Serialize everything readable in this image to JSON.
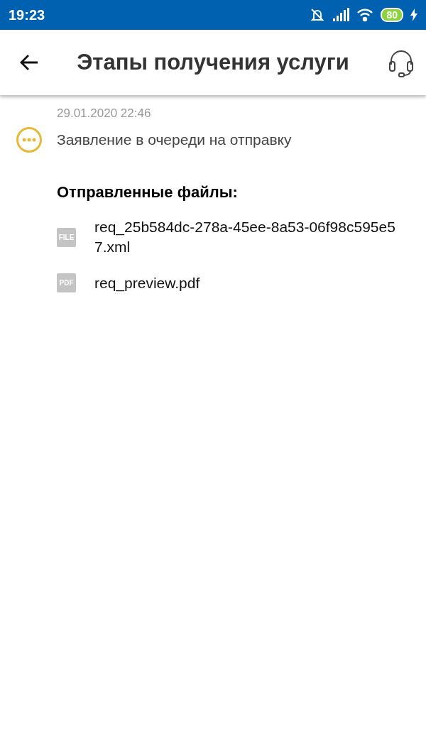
{
  "status_bar": {
    "time": "19:23",
    "battery": "80"
  },
  "header": {
    "title": "Этапы получения услуги"
  },
  "event": {
    "date": "29.01.2020 22:46",
    "status": "Заявление в очереди на отправку",
    "kind": "pending",
    "color": "#e8b937"
  },
  "files_heading": "Отправленные файлы:",
  "files": [
    {
      "badge": "FILE",
      "name": "req_25b584dc-278a-45ee-8a53-06f98c595e57.xml"
    },
    {
      "badge": "PDF",
      "name": "req_preview.pdf"
    }
  ]
}
